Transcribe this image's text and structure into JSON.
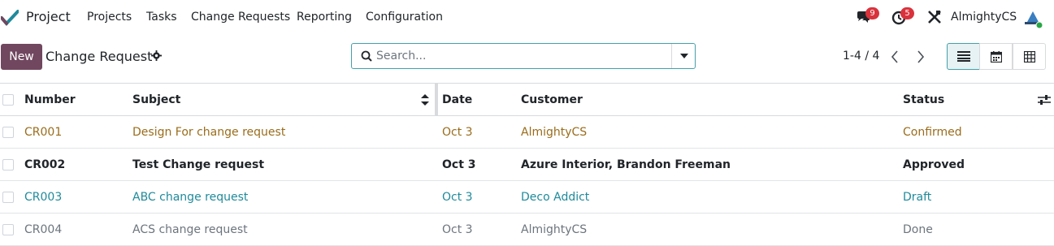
{
  "navbar": {
    "app_name": "Project",
    "menu": {
      "projects": "Projects",
      "tasks": "Tasks",
      "change_requests": "Change Requests",
      "reporting": "Reporting",
      "configuration": "Configuration"
    },
    "messages_count": "9",
    "activities_count": "5",
    "company": "AlmightyCS",
    "icons": [
      "app-logo-icon",
      "chat-icon",
      "clock-icon",
      "tools-icon",
      "avatar"
    ]
  },
  "control_panel": {
    "new_label": "New",
    "title": "Change Request",
    "search_placeholder": "Search...",
    "pager": "1-4 / 4"
  },
  "table": {
    "headers": {
      "number": "Number",
      "subject": "Subject",
      "date": "Date",
      "customer": "Customer",
      "status": "Status"
    },
    "rows": [
      {
        "number": "CR001",
        "subject": "Design For change request",
        "date": "Oct 3",
        "customer": "AlmightyCS",
        "status": "Confirmed"
      },
      {
        "number": "CR002",
        "subject": "Test Change request",
        "date": "Oct 3",
        "customer": "Azure Interior, Brandon Freeman",
        "status": "Approved"
      },
      {
        "number": "CR003",
        "subject": "ABC change request",
        "date": "Oct 3",
        "customer": "Deco Addict",
        "status": "Draft"
      },
      {
        "number": "CR004",
        "subject": "ACS change request",
        "date": "Oct 3",
        "customer": "AlmightyCS",
        "status": "Done"
      }
    ]
  },
  "colors": {
    "brand": "#71475f",
    "accent": "#45a0aa",
    "badge": "#d9323c",
    "confirmed": "#9a6c1b",
    "draft": "#1f8a9b",
    "done": "#6c757d"
  }
}
